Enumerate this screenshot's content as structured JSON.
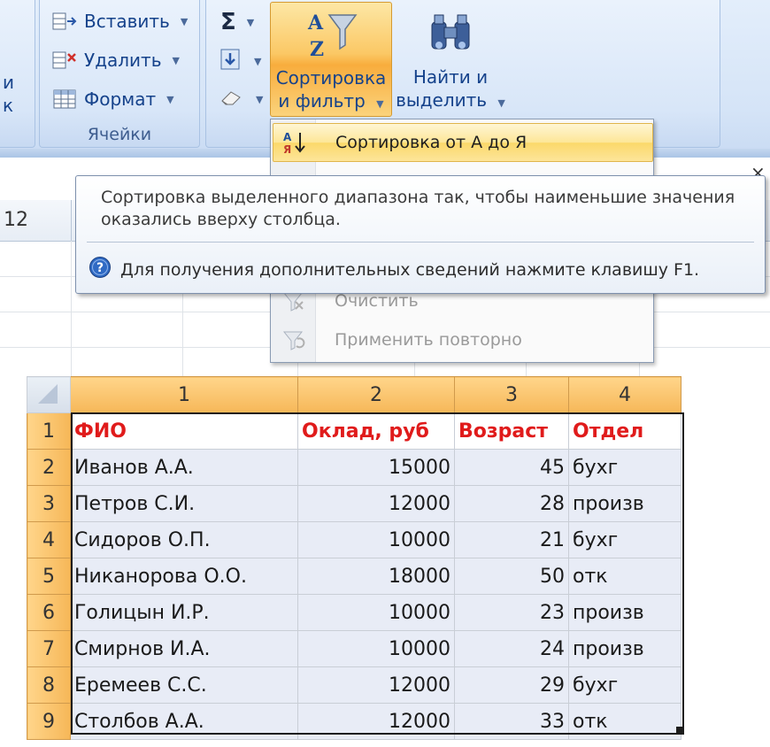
{
  "ribbon": {
    "cells_group": {
      "label": "Ячейки",
      "insert": "Вставить",
      "delete": "Удалить",
      "format": "Формат"
    },
    "left_partial": [
      "и",
      "к"
    ],
    "editing": {
      "sort_filter_line1": "Сортировка",
      "sort_filter_line2": "и фильтр",
      "find_select_line1": "Найти и",
      "find_select_line2": "выделить"
    }
  },
  "namebox_fragment": "12",
  "menu": {
    "items": [
      {
        "label": "Сортировка от А до Я",
        "state": "highlighted"
      },
      {
        "label": "Очистить",
        "state": "disabled"
      },
      {
        "label": "Применить повторно",
        "state": "disabled"
      }
    ]
  },
  "tooltip": {
    "description": "Сортировка выделенного диапазона так, чтобы наименьшие значения оказались вверху столбца.",
    "help": "Для получения дополнительных сведений нажмите клавишу F1."
  },
  "table": {
    "columns": [
      "1",
      "2",
      "3",
      "4"
    ],
    "rows": [
      {
        "n": "1",
        "c": [
          "ФИО",
          "Оклад, руб",
          "Возраст",
          "Отдел"
        ]
      },
      {
        "n": "2",
        "c": [
          "Иванов А.А.",
          "15000",
          "45",
          "бухг"
        ]
      },
      {
        "n": "3",
        "c": [
          "Петров С.И.",
          "12000",
          "28",
          "произв"
        ]
      },
      {
        "n": "4",
        "c": [
          "Сидоров О.П.",
          "10000",
          "21",
          "бухг"
        ]
      },
      {
        "n": "5",
        "c": [
          "Никанорова О.О.",
          "18000",
          "50",
          "отк"
        ]
      },
      {
        "n": "6",
        "c": [
          "Голицын И.Р.",
          "10000",
          "23",
          "произв"
        ]
      },
      {
        "n": "7",
        "c": [
          "Смирнов И.А.",
          "10000",
          "24",
          "произв"
        ]
      },
      {
        "n": "8",
        "c": [
          "Еремеев С.С.",
          "12000",
          "29",
          "бухг"
        ]
      },
      {
        "n": "9",
        "c": [
          "Столбов А.А.",
          "12000",
          "33",
          "отк"
        ]
      }
    ]
  },
  "colors": {
    "header_text": "#e01b1b",
    "header_band": "#f6b758",
    "cell_fill": "#e8ecf6",
    "ribbon_text": "#15428b"
  }
}
